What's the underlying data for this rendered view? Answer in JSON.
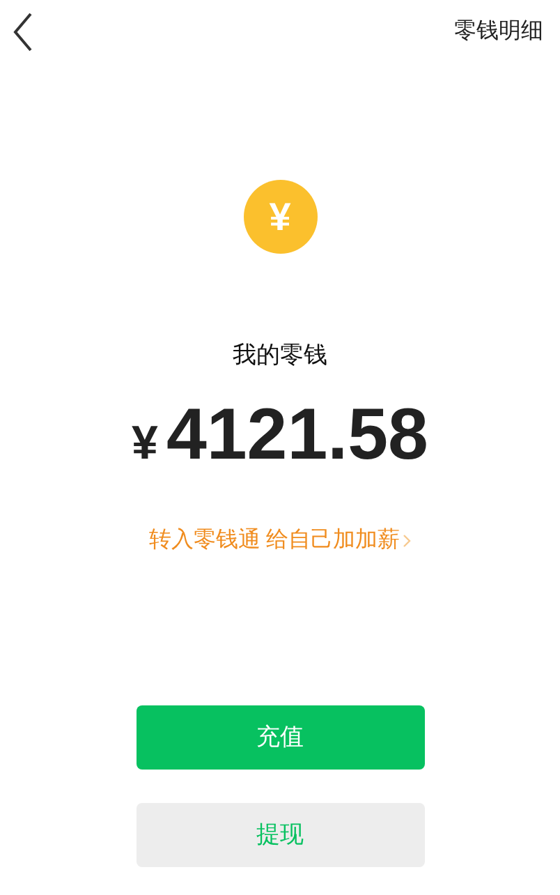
{
  "header": {
    "action": "零钱明细"
  },
  "coin": {
    "symbol": "¥"
  },
  "balance": {
    "label": "我的零钱",
    "currency": "¥",
    "amount": "4121.58"
  },
  "promo": {
    "text": "转入零钱通 给自己加加薪"
  },
  "buttons": [
    {
      "label": "充值",
      "kind": "primary"
    },
    {
      "label": "提现",
      "kind": "secondary"
    }
  ]
}
